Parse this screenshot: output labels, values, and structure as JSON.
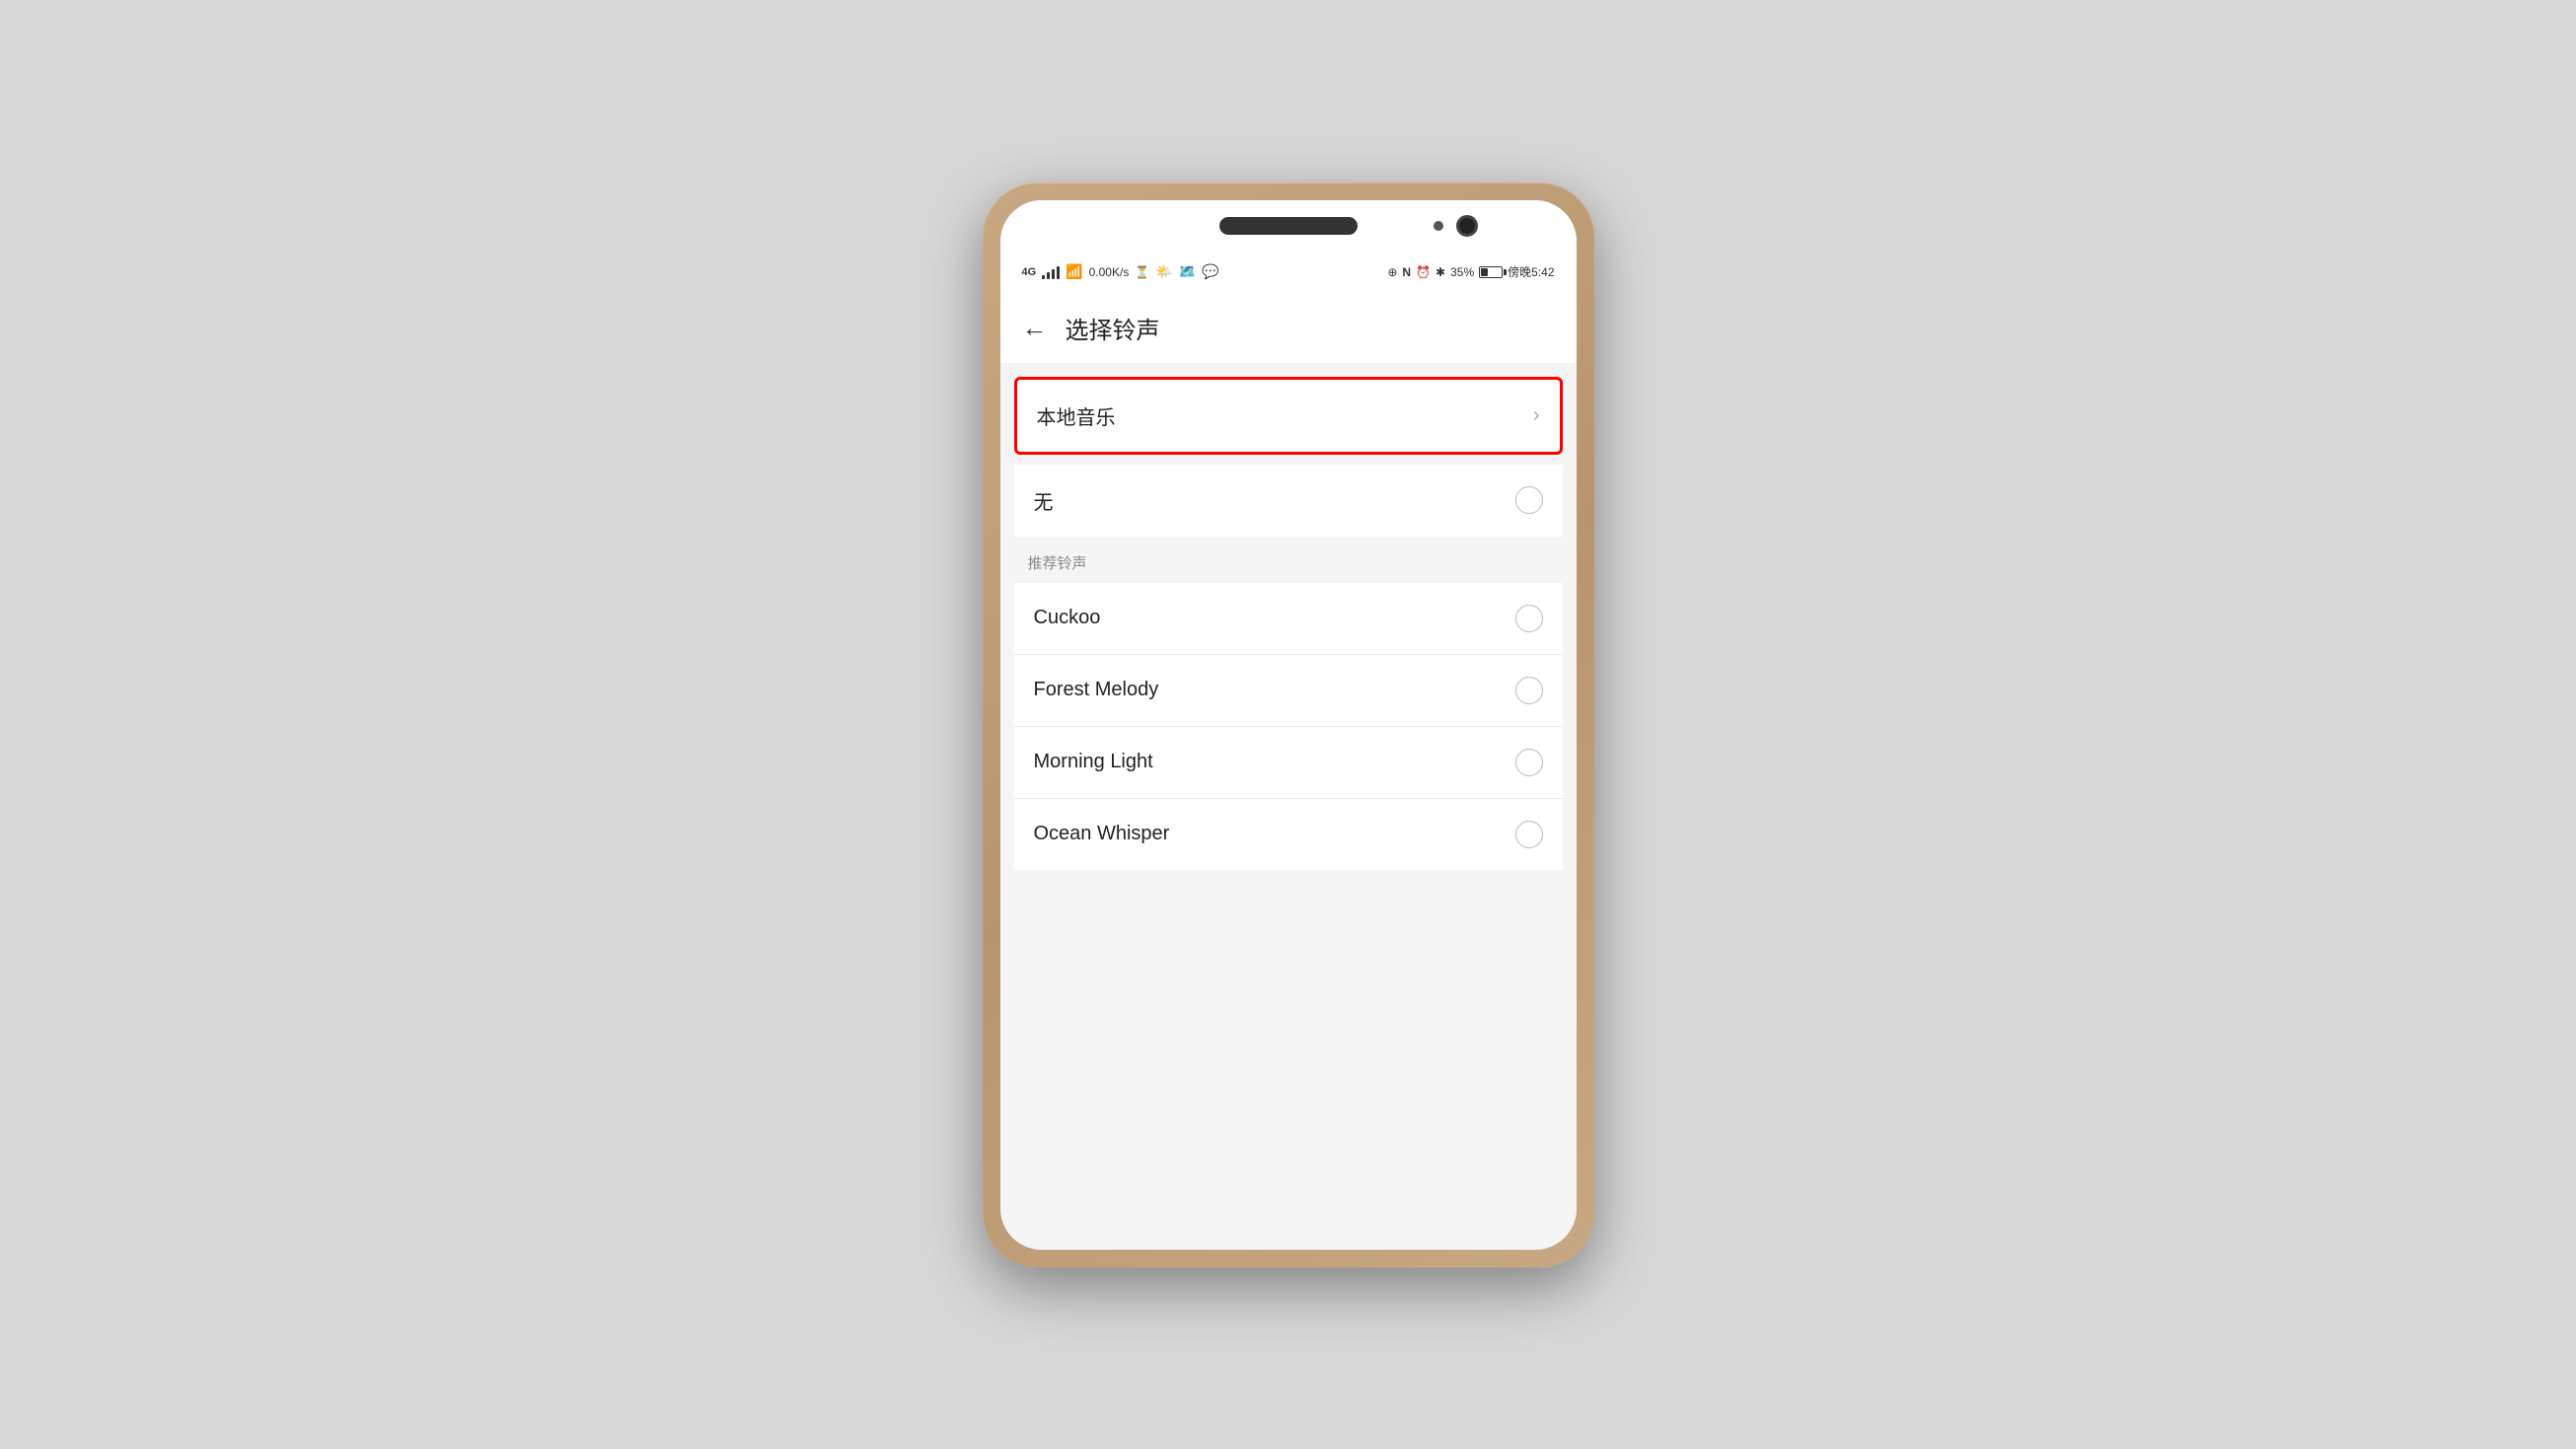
{
  "phone": {
    "status_bar": {
      "left": {
        "network_type": "4G",
        "speed": "0.00K/s"
      },
      "right": {
        "battery_percent": "35%",
        "time": "傍晚5:42"
      }
    },
    "header": {
      "back_label": "←",
      "title": "选择铃声"
    },
    "local_music": {
      "label": "本地音乐",
      "chevron": "›"
    },
    "none_option": {
      "label": "无"
    },
    "section": {
      "label": "推荐铃声"
    },
    "ringtones": [
      {
        "name": "Cuckoo"
      },
      {
        "name": "Forest Melody"
      },
      {
        "name": "Morning Light"
      },
      {
        "name": "Ocean Whisper"
      }
    ]
  }
}
